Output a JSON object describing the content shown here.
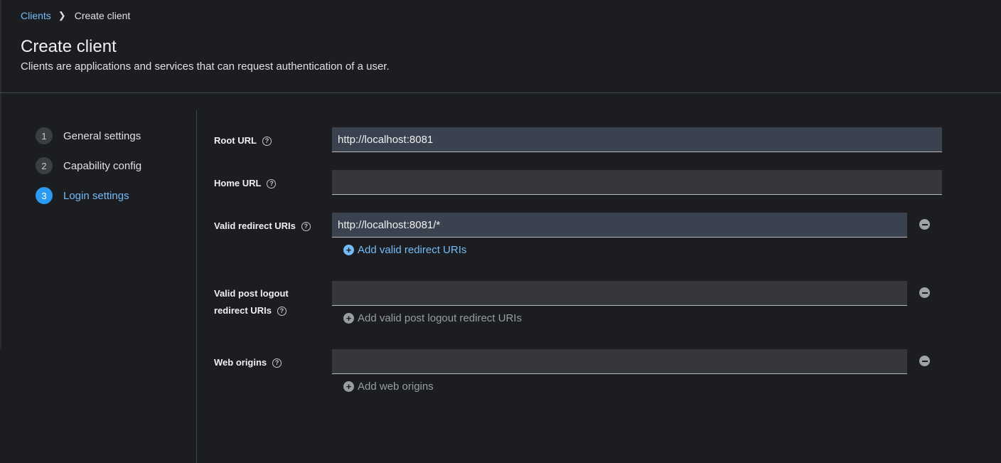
{
  "breadcrumb": {
    "parent": "Clients",
    "current": "Create client"
  },
  "header": {
    "title": "Create client",
    "description": "Clients are applications and services that can request authentication of a user."
  },
  "wizard": {
    "steps": [
      {
        "num": "1",
        "label": "General settings"
      },
      {
        "num": "2",
        "label": "Capability config"
      },
      {
        "num": "3",
        "label": "Login settings"
      }
    ],
    "active_step": "3"
  },
  "form": {
    "root_url": {
      "label": "Root URL",
      "value": "http://localhost:8081"
    },
    "home_url": {
      "label": "Home URL",
      "value": ""
    },
    "valid_redirect": {
      "label": "Valid redirect URIs",
      "value": "http://localhost:8081/*",
      "add_label": "Add valid redirect URIs"
    },
    "post_logout": {
      "label_line1": "Valid post logout",
      "label_line2": "redirect URIs",
      "value": "",
      "add_label": "Add valid post logout redirect URIs"
    },
    "web_origins": {
      "label": "Web origins",
      "value": "",
      "add_label": "Add web origins"
    }
  },
  "colors": {
    "accent": "#73bcf7",
    "active_step": "#2b9af3",
    "background": "#1b1d21"
  }
}
